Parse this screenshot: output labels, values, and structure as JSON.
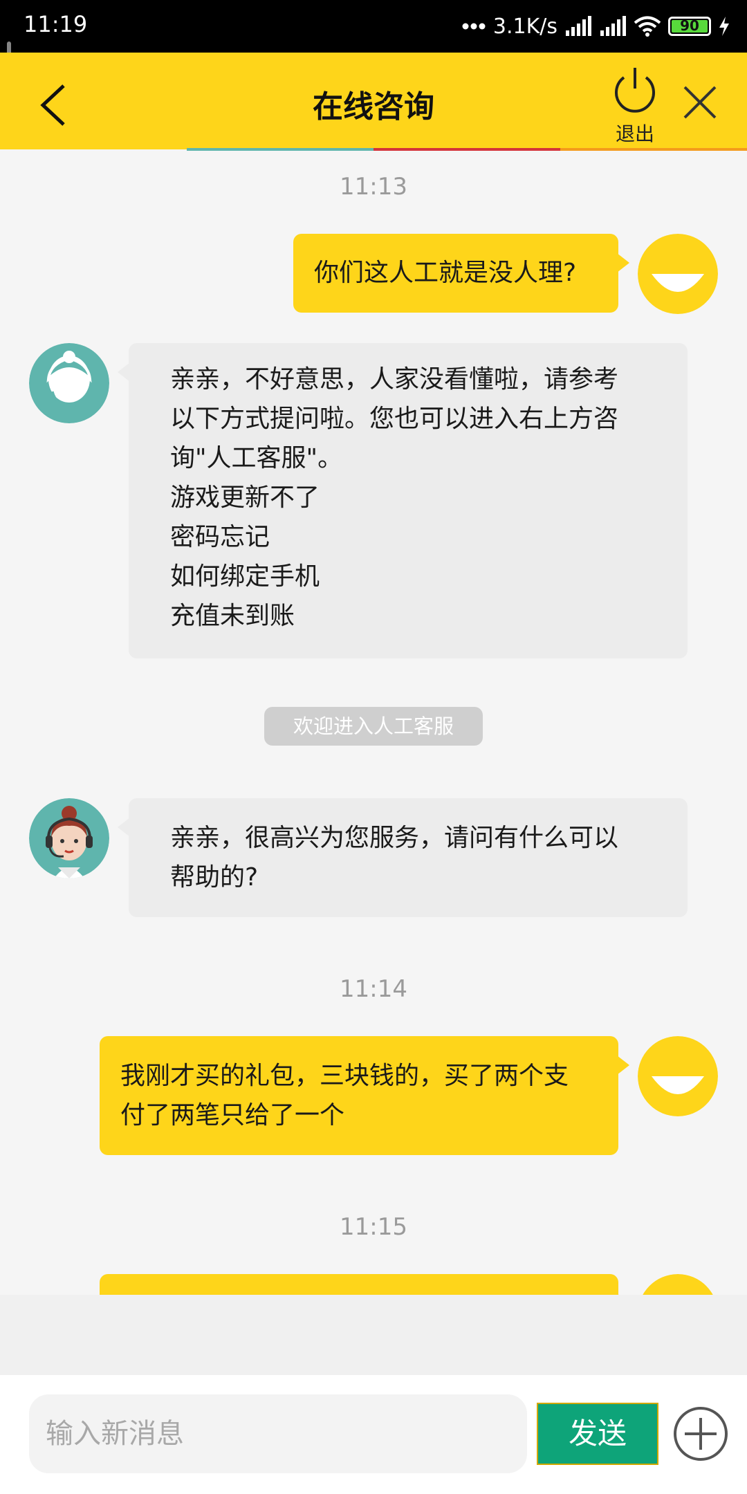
{
  "status_bar": {
    "time": "11:19",
    "network_speed": "3.1K/s",
    "battery": "90"
  },
  "header": {
    "title": "在线咨询",
    "exit_label": "退出",
    "back_icon": "chevron-left-icon",
    "exit_icon": "power-icon",
    "close_icon": "close-icon"
  },
  "chat": {
    "timestamps": [
      "11:13",
      "11:14",
      "11:15"
    ],
    "msg1": "你们这人工就是没人理?",
    "msg2_lines": [
      "亲亲，不好意思，人家没看懂啦，请参考",
      "以下方式提问啦。您也可以进入右上方咨",
      "询\"人工客服\"。",
      "游戏更新不了",
      "密码忘记",
      "如何绑定手机",
      "充值未到账"
    ],
    "system_notice": "欢迎进入人工客服",
    "msg3_lines": [
      "亲亲，很高兴为您服务，请问有什么可以",
      "帮助的?"
    ],
    "msg4_lines": [
      "我刚才买的礼包，三块钱的，买了两个支",
      "付了两笔只给了一个"
    ]
  },
  "input": {
    "placeholder": "输入新消息",
    "send_label": "发送",
    "plus_icon": "plus-circle-icon"
  },
  "colors": {
    "accent": "#fed51a",
    "send_button": "#0ea479",
    "agent_bubble": "#ececec"
  }
}
